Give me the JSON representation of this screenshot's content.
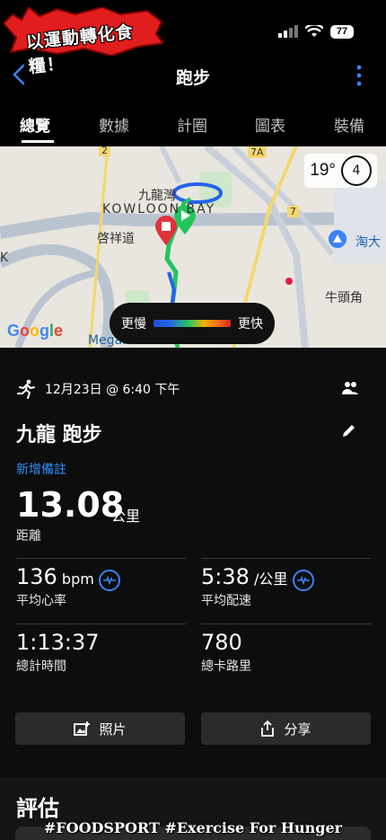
{
  "status_bar": {
    "banner_text": "以運動轉化食糧！",
    "battery": "77"
  },
  "nav": {
    "title": "跑步"
  },
  "tabs": [
    {
      "label": "總覽",
      "active": true
    },
    {
      "label": "數據",
      "active": false
    },
    {
      "label": "計圈",
      "active": false
    },
    {
      "label": "圖表",
      "active": false
    },
    {
      "label": "裝備",
      "active": false
    }
  ],
  "map": {
    "temperature": "19°",
    "wind": "4",
    "labels": {
      "area_cn": "九龍灣",
      "area_en": "KOWLOON BAY",
      "road": "啓祥道",
      "right_area": "牛頭角",
      "cut_right": "淘大",
      "bottom": "Megabox",
      "left_k": "K",
      "route_2": "2",
      "route_7a": "7A",
      "route_7": "7"
    },
    "legend_slow": "更慢",
    "legend_fast": "更快",
    "google": "Google"
  },
  "activity": {
    "date": "12月23日 @ 6:40 下午",
    "title": "九龍 跑步",
    "add_note": "新增備註",
    "distance": {
      "value": "13.08",
      "unit": "公里",
      "label": "距離"
    },
    "stats": [
      {
        "value": "136",
        "unit": "bpm",
        "label": "平均心率",
        "icon": true
      },
      {
        "value": "5:38",
        "unit": "/公里",
        "label": "平均配速",
        "icon": true
      },
      {
        "value": "1:13:37",
        "unit": "",
        "label": "總計時間",
        "icon": false
      },
      {
        "value": "780",
        "unit": "",
        "label": "總卡路里",
        "icon": false
      }
    ]
  },
  "buttons": {
    "photos": "照片",
    "share": "分享"
  },
  "evaluation": {
    "title": "評估"
  },
  "watermark": "#FOODSPORT #Exercise For Hunger"
}
